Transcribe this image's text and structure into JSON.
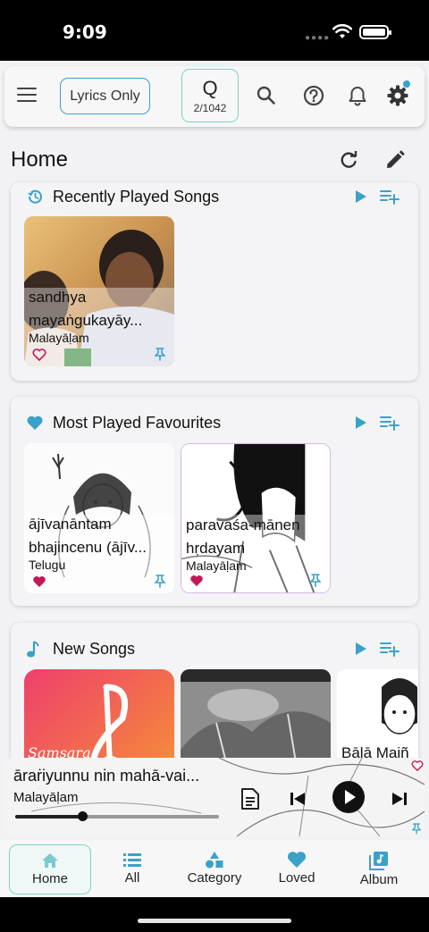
{
  "status": {
    "time": "9:09"
  },
  "toolbar": {
    "lyrics_only": "Lyrics Only",
    "queue_letter": "Q",
    "queue_count": "2/1042"
  },
  "page": {
    "title": "Home"
  },
  "sections": [
    {
      "title": "Recently Played Songs",
      "cards": [
        {
          "title": "sandhya mayaṅgukayāy...",
          "language": "Malayāḷam",
          "loved": false
        }
      ]
    },
    {
      "title": "Most Played Favourites",
      "cards": [
        {
          "title": "ājīvanāntam bhajincenu (ājīv...",
          "language": "Telugu",
          "loved": true
        },
        {
          "title": "paravaśa-mānen hṛdayam",
          "language": "Malayāḷam",
          "loved": true
        }
      ]
    },
    {
      "title": "New Songs",
      "cards": [
        {
          "title": "Samsara",
          "language": ""
        },
        {
          "title": "",
          "language": ""
        },
        {
          "title": "Bālā Maiñ",
          "language": ""
        }
      ]
    }
  ],
  "now_playing": {
    "title": "āraṙiyunnu nin mahā-vai...",
    "language": "Malayāḷam",
    "progress": 0.33
  },
  "nav": [
    {
      "label": "Home",
      "icon": "home-icon",
      "active": true
    },
    {
      "label": "All",
      "icon": "list-icon",
      "active": false
    },
    {
      "label": "Category",
      "icon": "category-icon",
      "active": false
    },
    {
      "label": "Loved",
      "icon": "heart-icon",
      "active": false
    },
    {
      "label": "Album",
      "icon": "album-icon",
      "active": false
    }
  ],
  "colors": {
    "accent": "#3aa2c9",
    "heart": "#c2185b",
    "active_outline": "#7ed3c2"
  }
}
